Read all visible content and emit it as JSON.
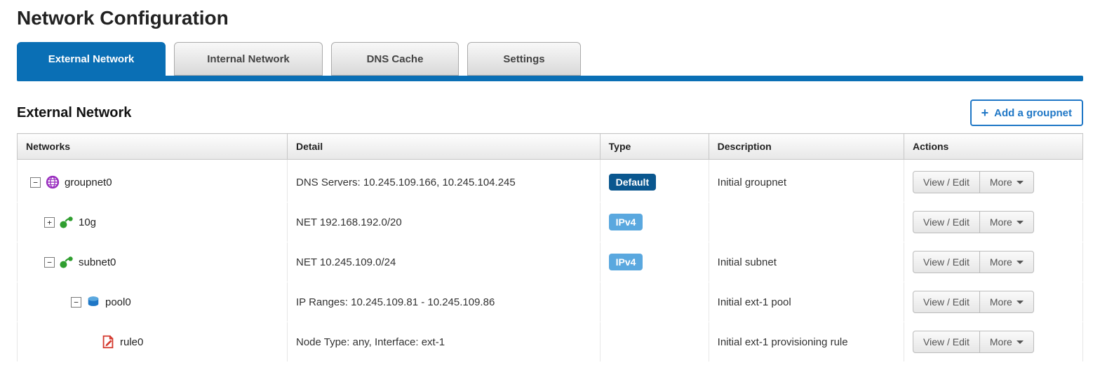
{
  "page_title": "Network Configuration",
  "tabs": [
    {
      "label": "External Network",
      "active": true
    },
    {
      "label": "Internal Network",
      "active": false
    },
    {
      "label": "DNS Cache",
      "active": false
    },
    {
      "label": "Settings",
      "active": false
    }
  ],
  "section_title": "External Network",
  "add_button_label": "Add a groupnet",
  "columns": {
    "networks": "Networks",
    "detail": "Detail",
    "type": "Type",
    "description": "Description",
    "actions": "Actions"
  },
  "action_labels": {
    "view_edit": "View / Edit",
    "more": "More"
  },
  "rows": [
    {
      "level": 0,
      "expander": "−",
      "icon": "globe",
      "name": "groupnet0",
      "detail": "DNS Servers: 10.245.109.166, 10.245.104.245",
      "type_badge": "Default",
      "type_style": "dark",
      "description": "Initial groupnet"
    },
    {
      "level": 1,
      "expander": "+",
      "icon": "subnet",
      "name": "10g",
      "detail": "NET 192.168.192.0/20",
      "type_badge": "IPv4",
      "type_style": "light",
      "description": ""
    },
    {
      "level": 1,
      "expander": "−",
      "icon": "subnet",
      "name": "subnet0",
      "detail": "NET 10.245.109.0/24",
      "type_badge": "IPv4",
      "type_style": "light",
      "description": "Initial subnet"
    },
    {
      "level": 2,
      "expander": "−",
      "icon": "pool",
      "name": "pool0",
      "detail": "IP Ranges: 10.245.109.81 - 10.245.109.86",
      "type_badge": "",
      "type_style": "",
      "description": "Initial ext-1 pool"
    },
    {
      "level": 3,
      "expander": "",
      "icon": "rule",
      "name": "rule0",
      "detail": "Node Type: any, Interface: ext-1",
      "type_badge": "",
      "type_style": "",
      "description": "Initial ext-1 provisioning rule"
    }
  ]
}
